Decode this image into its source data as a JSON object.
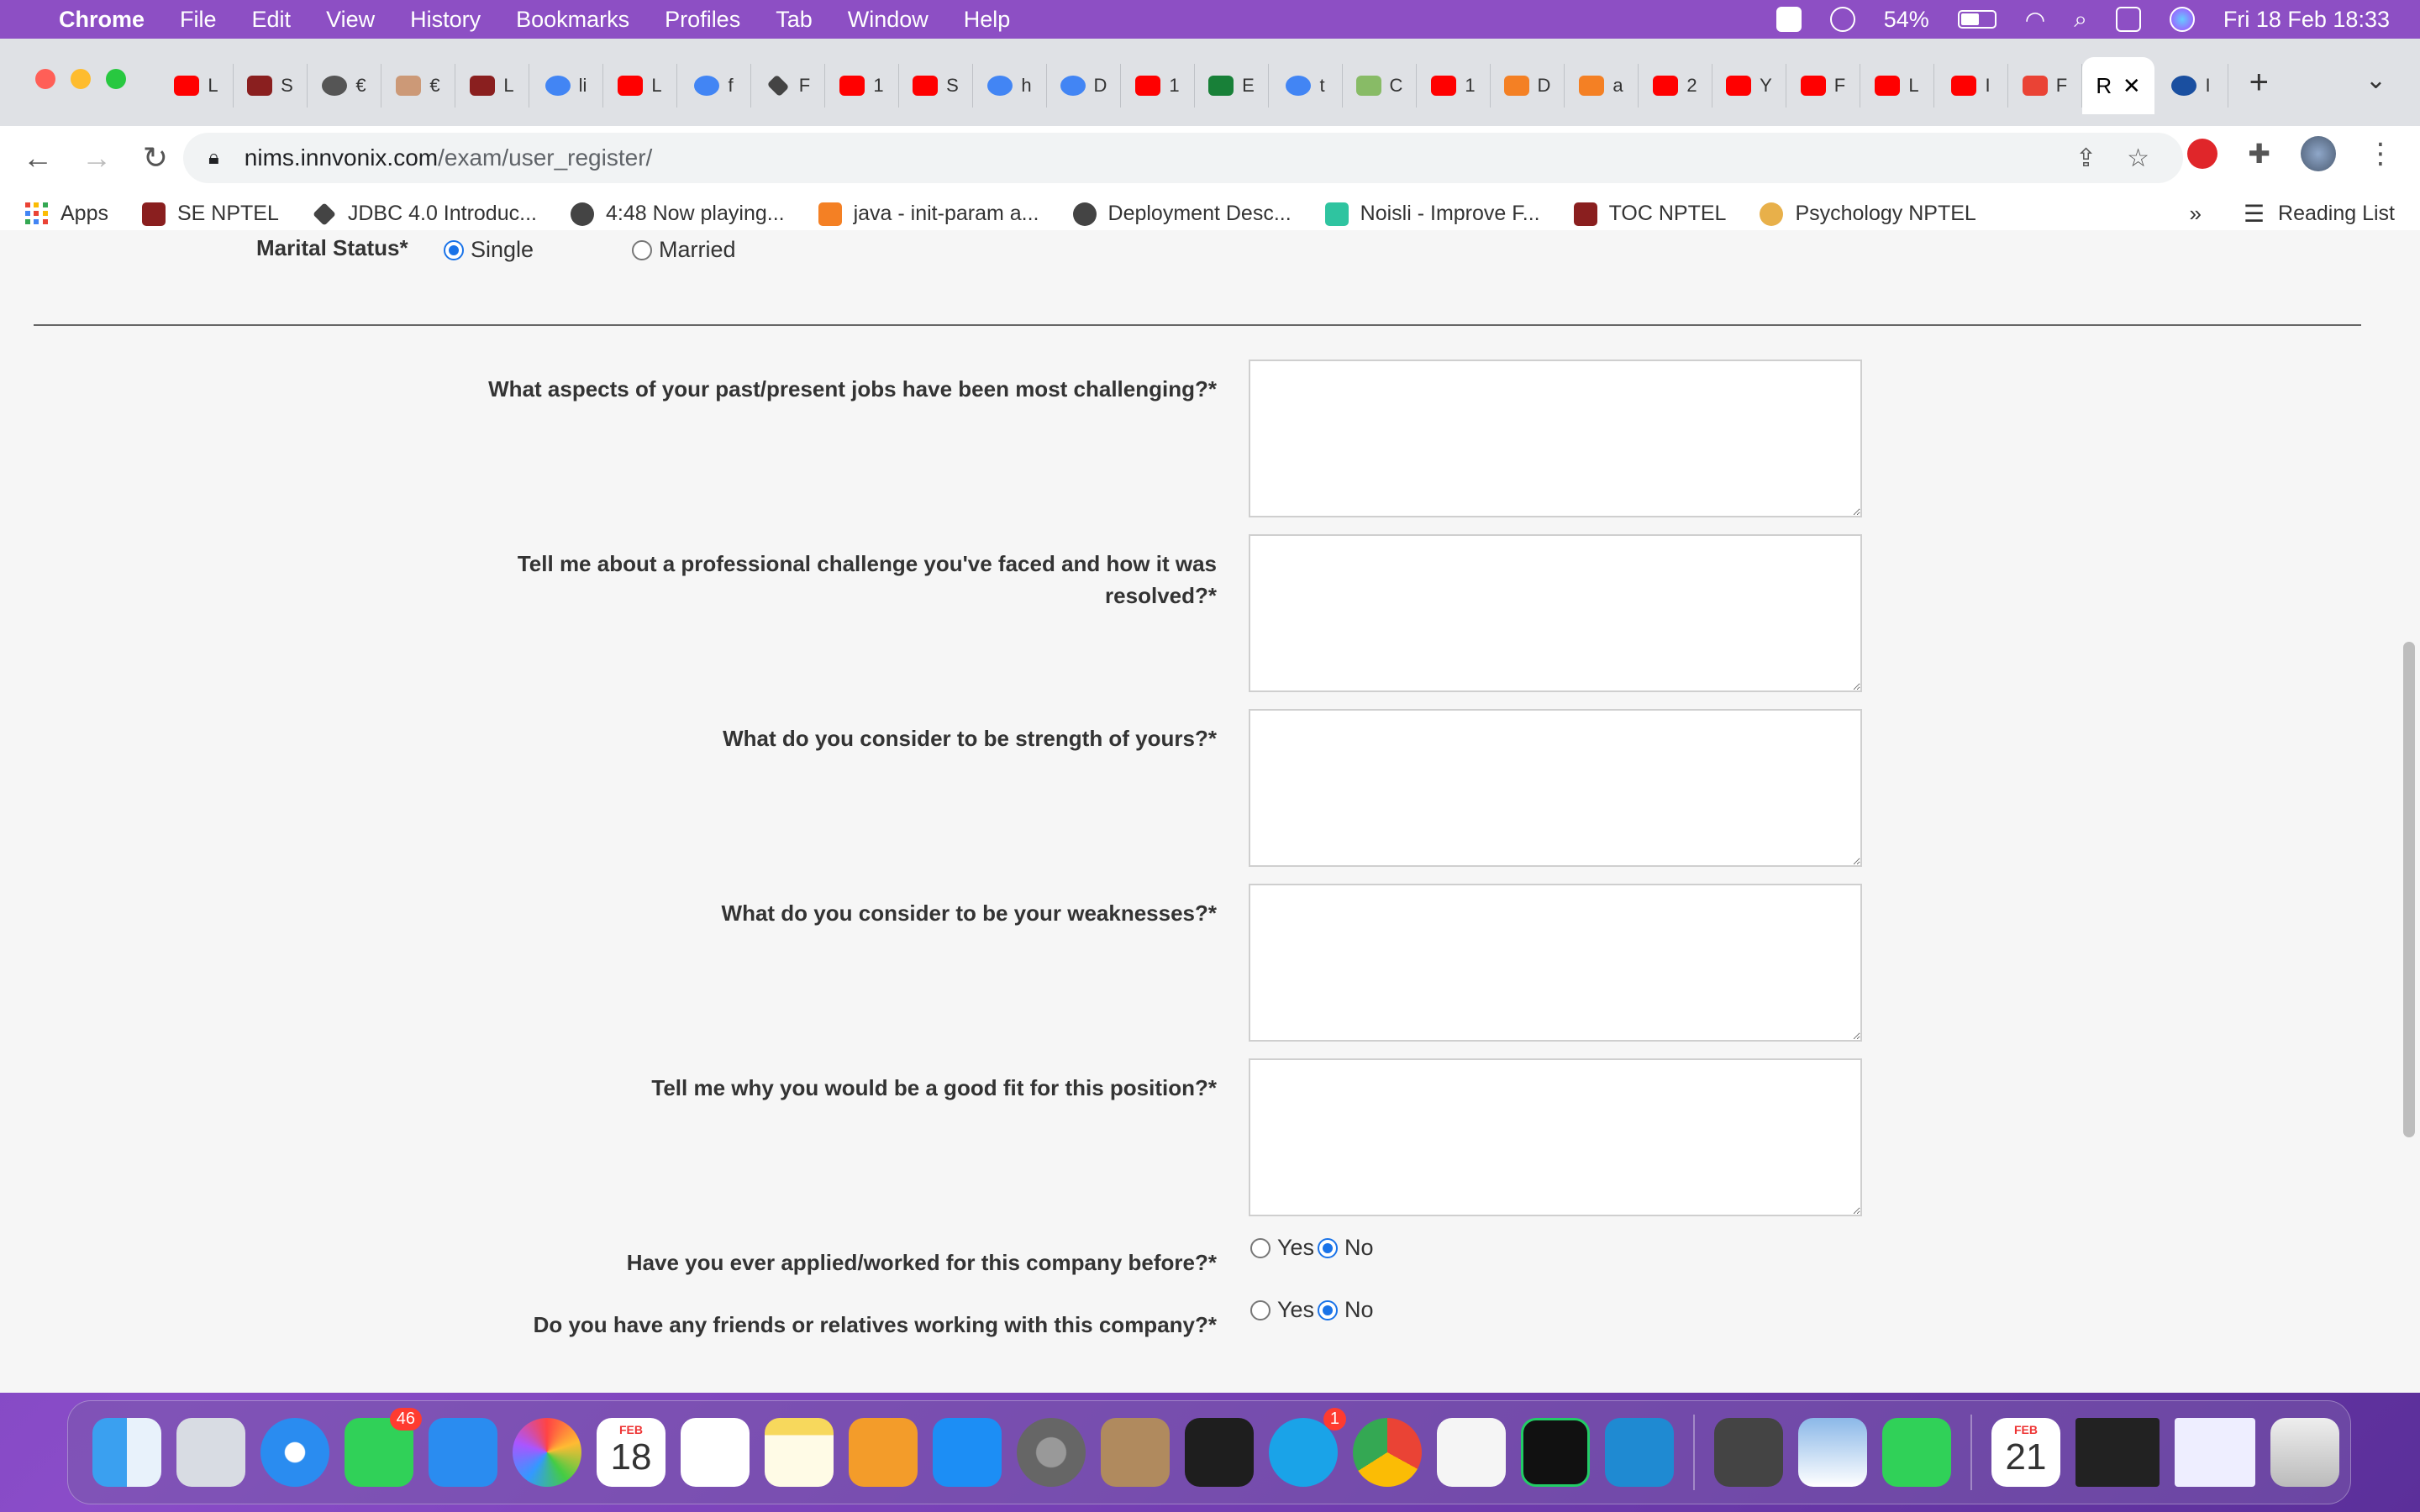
{
  "menubar": {
    "app": "Chrome",
    "items": [
      "File",
      "Edit",
      "View",
      "History",
      "Bookmarks",
      "Profiles",
      "Tab",
      "Window",
      "Help"
    ],
    "battery": "54%",
    "datetime": "Fri 18 Feb  18:33"
  },
  "tabs": {
    "mini": [
      "L",
      "S",
      "€",
      "€",
      "L",
      "li",
      "L",
      "f",
      "F",
      "1",
      "S",
      "h",
      "D",
      "1",
      "E",
      "t",
      "C",
      "1",
      "D",
      "a",
      "2",
      "Y",
      "F",
      "L",
      "I",
      "F"
    ],
    "active_label": "R",
    "last_label": "I"
  },
  "address": {
    "host": "nims.innvonix.com",
    "path": "/exam/user_register/"
  },
  "bookmarks": {
    "items": [
      "Apps",
      "SE NPTEL",
      "JDBC 4.0 Introduc...",
      "4:48 Now playing...",
      "java - init-param a...",
      "Deployment Desc...",
      "Noisli - Improve F...",
      "TOC NPTEL",
      "Psychology NPTEL"
    ],
    "overflow": "»",
    "reading_list": "Reading List"
  },
  "form": {
    "marital_label": "Marital Status*",
    "marital_single": "Single",
    "marital_married": "Married",
    "q1": "What aspects of your past/present jobs have been most challenging?*",
    "q2": "Tell me about a professional challenge you've faced and how it was resolved?*",
    "q3": "What do you consider to be strength of yours?*",
    "q4": "What do you consider to be your weaknesses?*",
    "q5": "Tell me why you would be a good fit for this position?*",
    "q6": "Have you ever applied/worked for this company before?*",
    "q7": "Do you have any friends or relatives working with this company?*",
    "yes": "Yes",
    "no": "No"
  },
  "dock": {
    "messages_badge": "46",
    "skype_badge": "1",
    "calendar_month": "FEB",
    "calendar_day": "18",
    "calendar2_day": "21"
  }
}
